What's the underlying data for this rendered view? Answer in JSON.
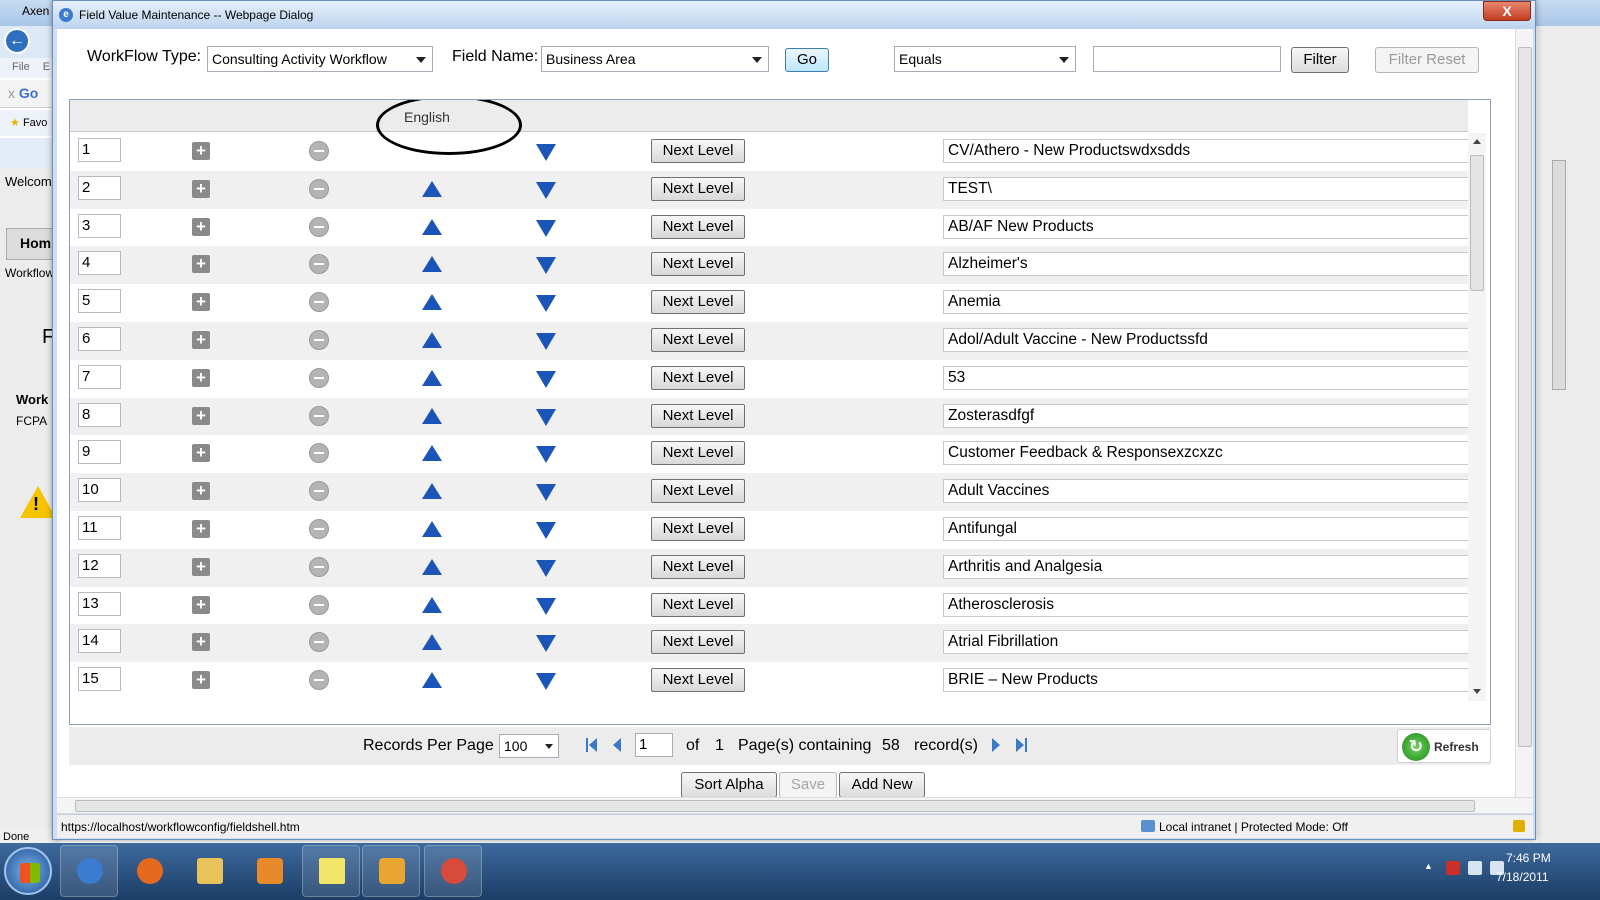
{
  "background": {
    "browser_title": "Axen",
    "menu_file": "File",
    "menu_e": "E",
    "google": "Go",
    "favorites": "Favo",
    "welcome": "Welcom",
    "home_tab": "Hom",
    "workflow_left": "Workflow",
    "f_text": "F",
    "work_label": "Work",
    "fcpa": "FCPA",
    "done": "Done"
  },
  "dialog": {
    "title": "Field Value Maintenance -- Webpage Dialog",
    "close_label": "X"
  },
  "toolbar": {
    "workflow_type_label": "WorkFlow Type:",
    "workflow_type_value": "Consulting Activity Workflow",
    "field_name_label": "Field Name:",
    "field_name_value": "Business Area",
    "go_label": "Go",
    "operator_value": "Equals",
    "filter_value": "",
    "filter_label": "Filter",
    "filter_reset_label": "Filter Reset"
  },
  "grid": {
    "header_language": "English",
    "next_level_label": "Next Level",
    "rows": [
      {
        "num": "1",
        "value": "CV/Athero - New Productswdxsdds"
      },
      {
        "num": "2",
        "value": "TEST\\"
      },
      {
        "num": "3",
        "value": "AB/AF New Products"
      },
      {
        "num": "4",
        "value": "Alzheimer's"
      },
      {
        "num": "5",
        "value": "Anemia"
      },
      {
        "num": "6",
        "value": "Adol/Adult Vaccine - New Productssfd"
      },
      {
        "num": "7",
        "value": "53"
      },
      {
        "num": "8",
        "value": "Zosterasdfgf"
      },
      {
        "num": "9",
        "value": "Customer Feedback & Responsexzcxzc"
      },
      {
        "num": "10",
        "value": "Adult Vaccines"
      },
      {
        "num": "11",
        "value": "Antifungal"
      },
      {
        "num": "12",
        "value": "Arthritis and Analgesia"
      },
      {
        "num": "13",
        "value": "Atherosclerosis"
      },
      {
        "num": "14",
        "value": "Atrial Fibrillation"
      },
      {
        "num": "15",
        "value": "BRIE – New Products"
      }
    ]
  },
  "pager": {
    "records_per_page_label": "Records Per Page",
    "records_per_page_value": "100",
    "page_value": "1",
    "of_label": "of",
    "total_pages": "1",
    "pages_containing_label": "Page(s) containing",
    "record_count": "58",
    "records_label": "record(s)",
    "refresh_label": "Refresh"
  },
  "actions": {
    "sort_alpha_label": "Sort Alpha",
    "save_label": "Save",
    "add_new_label": "Add New"
  },
  "status_bar": {
    "url": "https://localhost/workflowconfig/fieldshell.htm",
    "zone": "Local intranet | Protected Mode: Off"
  },
  "taskbar": {
    "time": "7:46 PM",
    "date": "7/18/2011"
  },
  "colors": {
    "arrow_blue": "#1c55b8",
    "dialog_frame": "#cfdff3",
    "close_red": "#c13d21",
    "taskbar": "#1c3d66"
  }
}
